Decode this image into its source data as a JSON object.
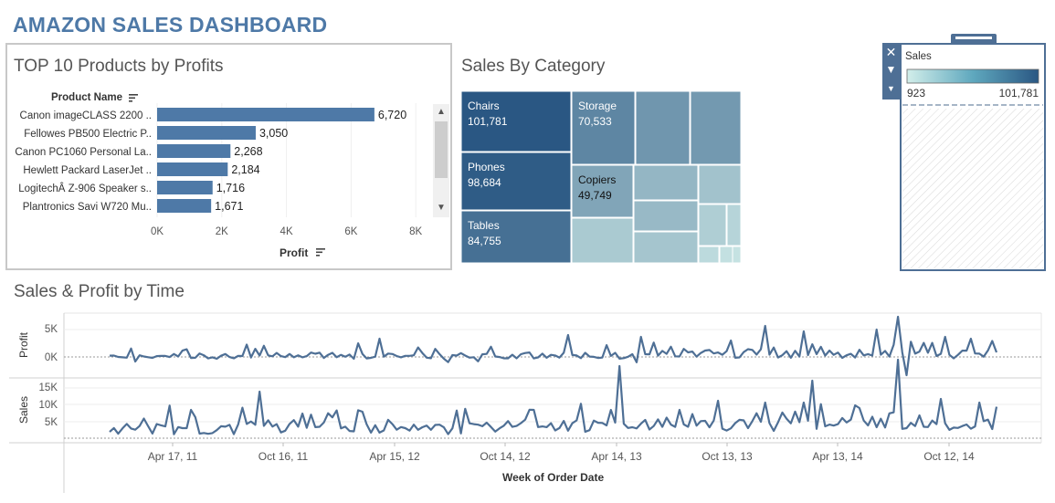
{
  "dashboard": {
    "title": "AMAZON SALES DASHBOARD"
  },
  "top10": {
    "title": "TOP 10 Products by Profits",
    "row_header": "Product Name",
    "axis_title": "Profit",
    "ticks": [
      "0K",
      "2K",
      "4K",
      "6K",
      "8K"
    ]
  },
  "category": {
    "title": "Sales By Category"
  },
  "legend": {
    "title": "Sales",
    "min_label": "923",
    "max_label": "101,781",
    "min_color": "#d2eeea",
    "max_color": "#2a5783"
  },
  "time": {
    "title": "Sales & Profit by Time",
    "profit_axis_title": "Profit",
    "sales_axis_title": "Sales",
    "x_axis_title": "Week of Order Date",
    "profit_ticks": [
      "5K",
      "0K"
    ],
    "sales_ticks": [
      "15K",
      "10K",
      "5K"
    ],
    "date_ticks": [
      "Apr 17, 11",
      "Oct 16, 11",
      "Apr 15, 12",
      "Oct 14, 12",
      "Apr 14, 13",
      "Oct 13, 13",
      "Apr 13, 14",
      "Oct 12, 14"
    ]
  },
  "colors": {
    "bar": "#4e79a7",
    "line": "#4e6f95",
    "title": "#4e79a7"
  },
  "chart_data": [
    {
      "type": "bar",
      "title": "TOP 10 Products by Profits",
      "orientation": "horizontal",
      "categories": [
        "Canon imageCLASS 2200 ..",
        "Fellowes PB500 Electric P..",
        "Canon PC1060 Personal La..",
        "Hewlett Packard LaserJet ..",
        "LogitechÂ Z-906 Speaker s..",
        "Plantronics Savi W720 Mu.."
      ],
      "values": [
        6720,
        3050,
        2268,
        2184,
        1716,
        1671
      ],
      "value_labels": [
        "6,720",
        "3,050",
        "2,268",
        "2,184",
        "1,716",
        "1,671"
      ],
      "xlabel": "Profit",
      "ylabel": "Product Name",
      "xlim": [
        0,
        8000
      ],
      "grid": true
    },
    {
      "type": "heatmap",
      "subtype": "treemap",
      "title": "Sales By Category",
      "labeled_cells": [
        {
          "category": "Chairs",
          "value": 101781,
          "label": "101,781"
        },
        {
          "category": "Storage",
          "value": 70533,
          "label": "70,533"
        },
        {
          "category": "Phones",
          "value": 98684,
          "label": "98,684"
        },
        {
          "category": "Copiers",
          "value": 49749,
          "label": "49,749"
        },
        {
          "category": "Tables",
          "value": 84755,
          "label": "84,755"
        }
      ],
      "unlabeled_cell_count": 12,
      "color_range": [
        "#d2eeea",
        "#2a5783"
      ],
      "value_range": [
        923,
        101781
      ]
    },
    {
      "type": "line",
      "title": "Sales & Profit by Time",
      "xlabel": "Week of Order Date",
      "x_range": [
        "2011-01",
        "2014-12"
      ],
      "panels": [
        {
          "name": "Profit",
          "ylim": [
            -3000,
            8000
          ],
          "ticks": [
            "5K",
            "0K"
          ]
        },
        {
          "name": "Sales",
          "ylim": [
            0,
            18000
          ],
          "ticks": [
            "15K",
            "10K",
            "5K"
          ]
        }
      ],
      "notable_points": [
        {
          "series": "Profit",
          "x": "2014-03",
          "y": 7200
        },
        {
          "series": "Profit",
          "x": "2014-04",
          "y": -2900
        },
        {
          "series": "Sales",
          "x": "2013-03",
          "y": 16500
        },
        {
          "series": "Sales",
          "x": "2014-03",
          "y": 17500
        },
        {
          "series": "Sales",
          "x": "2011-09",
          "y": 12000
        }
      ]
    }
  ]
}
